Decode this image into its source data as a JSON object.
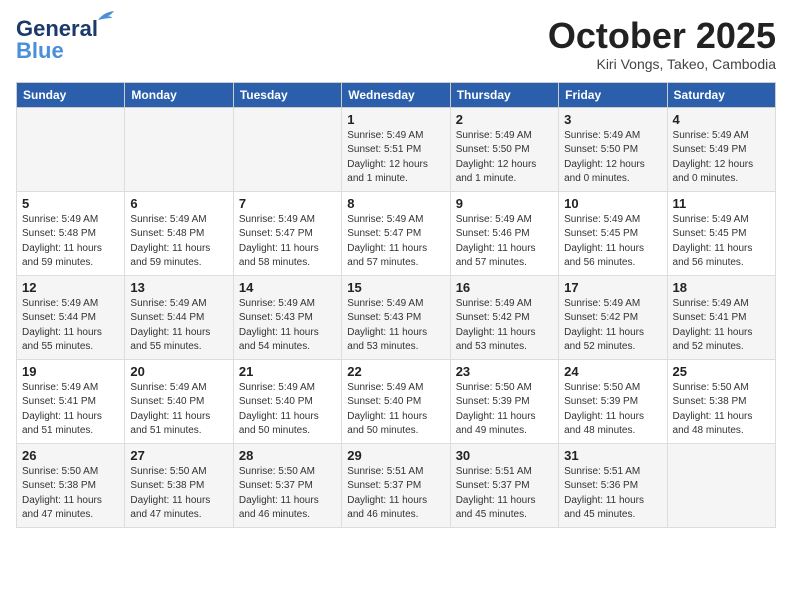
{
  "header": {
    "logo_line1": "General",
    "logo_line2": "Blue",
    "month": "October 2025",
    "location": "Kiri Vongs, Takeo, Cambodia"
  },
  "days_of_week": [
    "Sunday",
    "Monday",
    "Tuesday",
    "Wednesday",
    "Thursday",
    "Friday",
    "Saturday"
  ],
  "weeks": [
    [
      {
        "day": "",
        "text": ""
      },
      {
        "day": "",
        "text": ""
      },
      {
        "day": "",
        "text": ""
      },
      {
        "day": "1",
        "text": "Sunrise: 5:49 AM\nSunset: 5:51 PM\nDaylight: 12 hours\nand 1 minute."
      },
      {
        "day": "2",
        "text": "Sunrise: 5:49 AM\nSunset: 5:50 PM\nDaylight: 12 hours\nand 1 minute."
      },
      {
        "day": "3",
        "text": "Sunrise: 5:49 AM\nSunset: 5:50 PM\nDaylight: 12 hours\nand 0 minutes."
      },
      {
        "day": "4",
        "text": "Sunrise: 5:49 AM\nSunset: 5:49 PM\nDaylight: 12 hours\nand 0 minutes."
      }
    ],
    [
      {
        "day": "5",
        "text": "Sunrise: 5:49 AM\nSunset: 5:48 PM\nDaylight: 11 hours\nand 59 minutes."
      },
      {
        "day": "6",
        "text": "Sunrise: 5:49 AM\nSunset: 5:48 PM\nDaylight: 11 hours\nand 59 minutes."
      },
      {
        "day": "7",
        "text": "Sunrise: 5:49 AM\nSunset: 5:47 PM\nDaylight: 11 hours\nand 58 minutes."
      },
      {
        "day": "8",
        "text": "Sunrise: 5:49 AM\nSunset: 5:47 PM\nDaylight: 11 hours\nand 57 minutes."
      },
      {
        "day": "9",
        "text": "Sunrise: 5:49 AM\nSunset: 5:46 PM\nDaylight: 11 hours\nand 57 minutes."
      },
      {
        "day": "10",
        "text": "Sunrise: 5:49 AM\nSunset: 5:45 PM\nDaylight: 11 hours\nand 56 minutes."
      },
      {
        "day": "11",
        "text": "Sunrise: 5:49 AM\nSunset: 5:45 PM\nDaylight: 11 hours\nand 56 minutes."
      }
    ],
    [
      {
        "day": "12",
        "text": "Sunrise: 5:49 AM\nSunset: 5:44 PM\nDaylight: 11 hours\nand 55 minutes."
      },
      {
        "day": "13",
        "text": "Sunrise: 5:49 AM\nSunset: 5:44 PM\nDaylight: 11 hours\nand 55 minutes."
      },
      {
        "day": "14",
        "text": "Sunrise: 5:49 AM\nSunset: 5:43 PM\nDaylight: 11 hours\nand 54 minutes."
      },
      {
        "day": "15",
        "text": "Sunrise: 5:49 AM\nSunset: 5:43 PM\nDaylight: 11 hours\nand 53 minutes."
      },
      {
        "day": "16",
        "text": "Sunrise: 5:49 AM\nSunset: 5:42 PM\nDaylight: 11 hours\nand 53 minutes."
      },
      {
        "day": "17",
        "text": "Sunrise: 5:49 AM\nSunset: 5:42 PM\nDaylight: 11 hours\nand 52 minutes."
      },
      {
        "day": "18",
        "text": "Sunrise: 5:49 AM\nSunset: 5:41 PM\nDaylight: 11 hours\nand 52 minutes."
      }
    ],
    [
      {
        "day": "19",
        "text": "Sunrise: 5:49 AM\nSunset: 5:41 PM\nDaylight: 11 hours\nand 51 minutes."
      },
      {
        "day": "20",
        "text": "Sunrise: 5:49 AM\nSunset: 5:40 PM\nDaylight: 11 hours\nand 51 minutes."
      },
      {
        "day": "21",
        "text": "Sunrise: 5:49 AM\nSunset: 5:40 PM\nDaylight: 11 hours\nand 50 minutes."
      },
      {
        "day": "22",
        "text": "Sunrise: 5:49 AM\nSunset: 5:40 PM\nDaylight: 11 hours\nand 50 minutes."
      },
      {
        "day": "23",
        "text": "Sunrise: 5:50 AM\nSunset: 5:39 PM\nDaylight: 11 hours\nand 49 minutes."
      },
      {
        "day": "24",
        "text": "Sunrise: 5:50 AM\nSunset: 5:39 PM\nDaylight: 11 hours\nand 48 minutes."
      },
      {
        "day": "25",
        "text": "Sunrise: 5:50 AM\nSunset: 5:38 PM\nDaylight: 11 hours\nand 48 minutes."
      }
    ],
    [
      {
        "day": "26",
        "text": "Sunrise: 5:50 AM\nSunset: 5:38 PM\nDaylight: 11 hours\nand 47 minutes."
      },
      {
        "day": "27",
        "text": "Sunrise: 5:50 AM\nSunset: 5:38 PM\nDaylight: 11 hours\nand 47 minutes."
      },
      {
        "day": "28",
        "text": "Sunrise: 5:50 AM\nSunset: 5:37 PM\nDaylight: 11 hours\nand 46 minutes."
      },
      {
        "day": "29",
        "text": "Sunrise: 5:51 AM\nSunset: 5:37 PM\nDaylight: 11 hours\nand 46 minutes."
      },
      {
        "day": "30",
        "text": "Sunrise: 5:51 AM\nSunset: 5:37 PM\nDaylight: 11 hours\nand 45 minutes."
      },
      {
        "day": "31",
        "text": "Sunrise: 5:51 AM\nSunset: 5:36 PM\nDaylight: 11 hours\nand 45 minutes."
      },
      {
        "day": "",
        "text": ""
      }
    ]
  ]
}
